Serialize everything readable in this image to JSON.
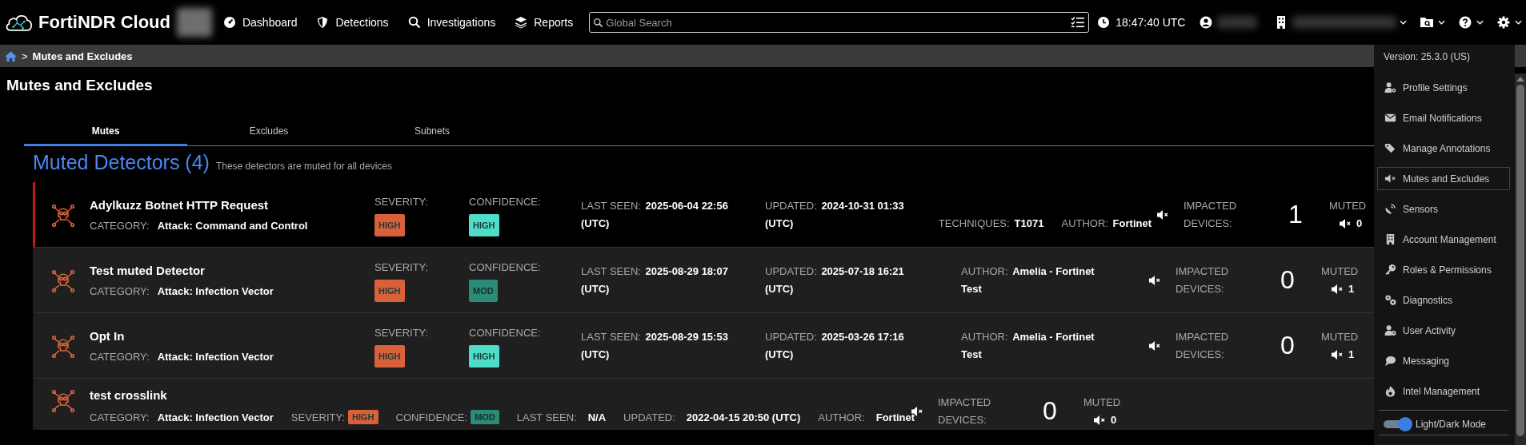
{
  "nav": {
    "brand": "FortiNDR Cloud",
    "links": [
      {
        "label": "Dashboard"
      },
      {
        "label": "Detections"
      },
      {
        "label": "Investigations"
      },
      {
        "label": "Reports"
      }
    ],
    "search": {
      "placeholder": "Global Search"
    },
    "clock": "18:47:40 UTC"
  },
  "breadcrumb": {
    "separator": ">",
    "current": "Mutes and Excludes"
  },
  "page_title": "Mutes and Excludes",
  "tabs": [
    {
      "label": "Mutes",
      "selected": true
    },
    {
      "label": "Excludes",
      "selected": false
    },
    {
      "label": "Subnets",
      "selected": false
    }
  ],
  "section": {
    "title": "Muted Detectors (4)",
    "subtitle": "These detectors are muted for all devices"
  },
  "detectors": [
    {
      "kind": "full",
      "selected": true,
      "name": "Adylkuzz Botnet HTTP Request",
      "category_label": "CATEGORY:",
      "category": "Attack: Command and Control",
      "severity_label": "SEVERITY:",
      "severity": {
        "text": "HIGH",
        "color": "#d8613c"
      },
      "confidence_label": "CONFIDENCE:",
      "confidence": {
        "text": "HIGH",
        "color": "#4fdcc8"
      },
      "last_seen_label": "LAST SEEN:",
      "last_seen": "2025-06-04 22:56 (UTC)",
      "updated_label": "UPDATED:",
      "updated": "2024-10-31 01:33 (UTC)",
      "techniques_label": "TECHNIQUES:",
      "techniques": "T1071",
      "author_label": "AUTHOR:",
      "author": "Fortinet",
      "impacted_label": "IMPACTED DEVICES:",
      "impacted": "1",
      "muted_label": "MUTED",
      "muted": "0"
    },
    {
      "kind": "full",
      "selected": false,
      "name": "Test muted Detector",
      "category_label": "CATEGORY:",
      "category": "Attack: Infection Vector",
      "severity_label": "SEVERITY:",
      "severity": {
        "text": "HIGH",
        "color": "#d8613c"
      },
      "confidence_label": "CONFIDENCE:",
      "confidence": {
        "text": "MOD",
        "color": "#2a8c78"
      },
      "last_seen_label": "LAST SEEN:",
      "last_seen": "2025-08-29 18:07 (UTC)",
      "updated_label": "UPDATED:",
      "updated": "2025-07-18 16:21 (UTC)",
      "author_label": "AUTHOR:",
      "author": "Amelia - Fortinet Test",
      "impacted_label": "IMPACTED DEVICES:",
      "impacted": "0",
      "muted_label": "MUTED",
      "muted": "1"
    },
    {
      "kind": "full",
      "selected": false,
      "name": "Opt In",
      "category_label": "CATEGORY:",
      "category": "Attack: Infection Vector",
      "severity_label": "SEVERITY:",
      "severity": {
        "text": "HIGH",
        "color": "#d8613c"
      },
      "confidence_label": "CONFIDENCE:",
      "confidence": {
        "text": "HIGH",
        "color": "#4fdcc8"
      },
      "last_seen_label": "LAST SEEN:",
      "last_seen": "2025-08-29 15:53 (UTC)",
      "updated_label": "UPDATED:",
      "updated": "2025-03-26 17:16 (UTC)",
      "author_label": "AUTHOR:",
      "author": "Amelia - Fortinet Test",
      "impacted_label": "IMPACTED DEVICES:",
      "impacted": "0",
      "muted_label": "MUTED",
      "muted": "1"
    },
    {
      "kind": "compact",
      "selected": false,
      "name": "test crosslink",
      "category_label": "CATEGORY:",
      "category": "Attack: Infection Vector",
      "severity_label": "SEVERITY:",
      "severity": {
        "text": "HIGH",
        "color": "#d8613c"
      },
      "confidence_label": "CONFIDENCE:",
      "confidence": {
        "text": "MOD",
        "color": "#2a8c78"
      },
      "last_seen_label": "LAST SEEN:",
      "last_seen": "N/A",
      "updated_label": "UPDATED:",
      "updated": "2022-04-15 20:50 (UTC)",
      "author_label": "AUTHOR:",
      "author": "Fortinet",
      "impacted_label": "IMPACTED DEVICES:",
      "impacted": "0",
      "muted_label": "MUTED",
      "muted": "0"
    }
  ],
  "menu": {
    "version": "Version: 25.3.0 (US)",
    "items": [
      {
        "label": "Profile Settings",
        "selected": false
      },
      {
        "label": "Email Notifications",
        "selected": false
      },
      {
        "label": "Manage Annotations",
        "selected": false
      },
      {
        "label": "Mutes and Excludes",
        "selected": true
      },
      {
        "label": "Sensors",
        "selected": false
      },
      {
        "label": "Account Management",
        "selected": false
      },
      {
        "label": "Roles & Permissions",
        "selected": false
      },
      {
        "label": "Diagnostics",
        "selected": false
      },
      {
        "label": "User Activity",
        "selected": false
      },
      {
        "label": "Messaging",
        "selected": false
      },
      {
        "label": "Intel Management",
        "selected": false
      }
    ],
    "toggle": {
      "label": "Light/Dark Mode",
      "on": true
    }
  }
}
